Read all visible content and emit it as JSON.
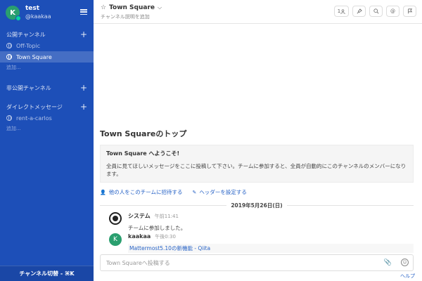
{
  "user": {
    "initial": "K",
    "name": "test",
    "handle": "@kaakaa"
  },
  "sidebar": {
    "public_title": "公開チャンネル",
    "public_channels": [
      {
        "label": "Off-Topic",
        "active": false
      },
      {
        "label": "Town Square",
        "active": true
      }
    ],
    "public_more": "追加...",
    "private_title": "非公開チャンネル",
    "dm_title": "ダイレクトメッセージ",
    "dm_items": [
      {
        "label": "rent-a-carlos"
      }
    ],
    "dm_more": "追加...",
    "footer_label": "チャンネル切替 - ⌘K"
  },
  "header": {
    "channel_name": "Town Square",
    "purpose": "チャンネル説明を追加",
    "member_count": "1",
    "icons": [
      "member-icon",
      "pin-icon",
      "search-icon",
      "mention-icon",
      "flag-icon"
    ]
  },
  "intro": {
    "title": "Town Squareのトップ",
    "welcome": "Town Square へようこそ!",
    "description": "全員に見てほしいメッセージをここに投稿して下さい。チームに参加すると、全員が自動的にこのチャンネルのメンバーになります。",
    "invite_label": "他の人をこのチームに招待する",
    "header_label": "ヘッダーを設定する"
  },
  "date_separator": "2019年5月26日(日)",
  "posts": [
    {
      "author": "システム",
      "time": "午前11:41",
      "text": "チームに参加しました。"
    },
    {
      "author": "kaakaa",
      "initial": "K",
      "time": "午後0:30",
      "link": "Mattermost5.10の新機能 - Qiita"
    }
  ],
  "input": {
    "placeholder": "Town Squareへ投稿する",
    "help": "ヘルプ"
  },
  "colors": {
    "sidebar_bg": "#1d4fb8",
    "link": "#2662c6",
    "avatar_green": "#2a9f6f"
  }
}
